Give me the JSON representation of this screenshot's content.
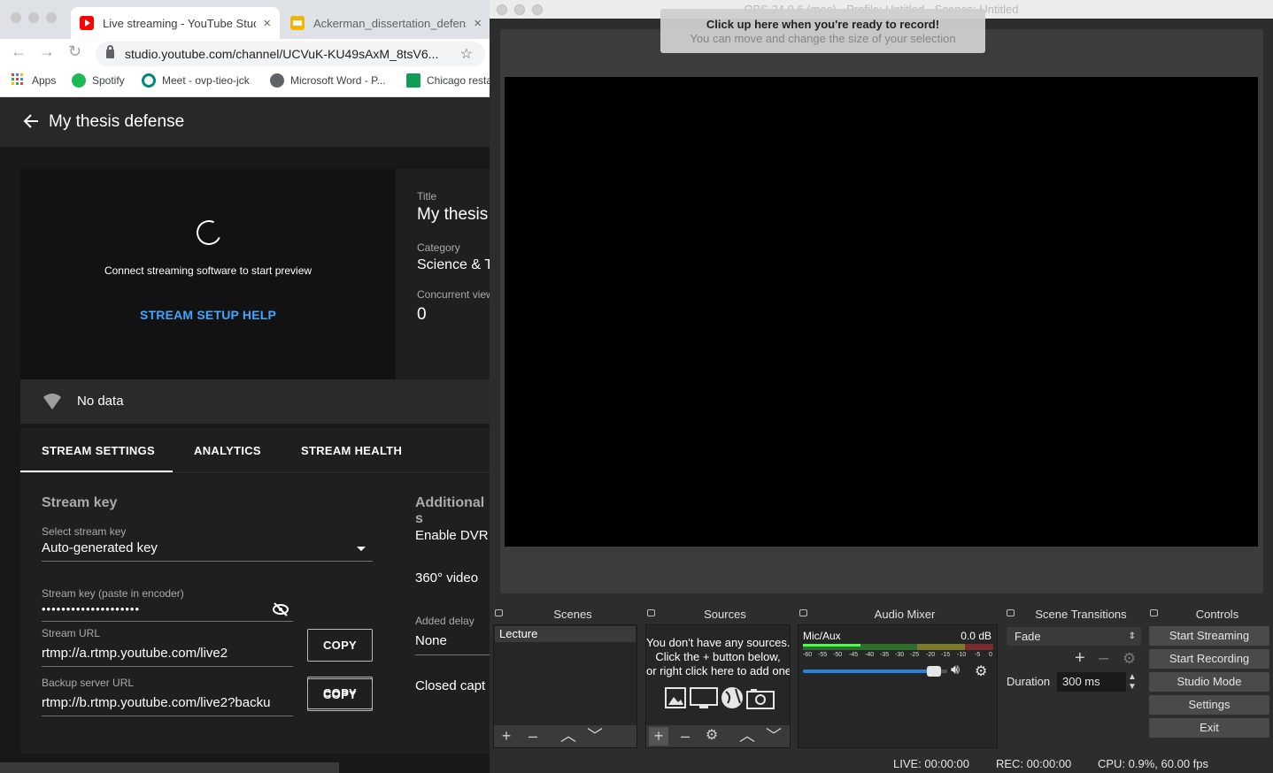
{
  "browser": {
    "tabs": [
      {
        "title": "Live streaming - YouTube Studio",
        "close": "×"
      },
      {
        "title": "Ackerman_dissertation_defense",
        "close": "×"
      }
    ],
    "url": "studio.youtube.com/channel/UCVuK-KU49sAxM_8tsV6...",
    "bookmarks": [
      "Apps",
      "Spotify",
      "Meet - ovp-tieo-jck",
      "Microsoft Word - P...",
      "Chicago resta"
    ]
  },
  "studio": {
    "page_title": "My thesis defense",
    "preview_message": "Connect streaming software to start preview",
    "setup_help": "STREAM SETUP HELP",
    "info": {
      "title_label": "Title",
      "title_value": "My thesis",
      "category_label": "Category",
      "category_value": "Science & T",
      "viewers_label": "Concurrent view",
      "viewers_value": "0"
    },
    "health": "No data",
    "tabs": [
      "STREAM SETTINGS",
      "ANALYTICS",
      "STREAM HEALTH"
    ],
    "stream_key_section": "Stream key",
    "select_key_label": "Select stream key",
    "select_key_value": "Auto-generated key",
    "key_label": "Stream key (paste in encoder)",
    "key_value": "••••••••••••••••••••",
    "url_label": "Stream URL",
    "url_value": "rtmp://a.rtmp.youtube.com/live2",
    "backup_label": "Backup server URL",
    "backup_value": "rtmp://b.rtmp.youtube.com/live2?backu",
    "copy": "COPY",
    "additional_section": "Additional s",
    "enable_dvr": "Enable DVR",
    "video360": "360° video",
    "delay_label": "Added delay",
    "delay_value": "None",
    "captions": "Closed capt"
  },
  "obs": {
    "window_title": "OBS 24.0.6 (mac) - Profile: Untitled - Scenes: Untitled",
    "tip_title": "Click up here when you're ready to record!",
    "tip_subtitle": "You can move and change the size of your selection",
    "docks": {
      "scenes": "Scenes",
      "sources": "Sources",
      "mixer": "Audio Mixer",
      "transitions": "Scene Transitions",
      "controls": "Controls"
    },
    "scene_item": "Lecture",
    "sources_empty": [
      "You don't have any sources.",
      "Click the + button below,",
      "or right click here to add one."
    ],
    "mixer": {
      "channel": "Mic/Aux",
      "level": "0.0 dB",
      "ticks": [
        "-60",
        "-55",
        "-50",
        "-45",
        "-40",
        "-35",
        "-30",
        "-25",
        "-20",
        "-15",
        "-10",
        "-5",
        "0"
      ],
      "volume": 0.95
    },
    "transition": "Fade",
    "duration_label": "Duration",
    "duration_value": "300 ms",
    "controls": [
      "Start Streaming",
      "Start Recording",
      "Studio Mode",
      "Settings",
      "Exit"
    ],
    "status": {
      "live": "LIVE: 00:00:00",
      "rec": "REC: 00:00:00",
      "cpu": "CPU: 0.9%, 60.00 fps"
    }
  }
}
